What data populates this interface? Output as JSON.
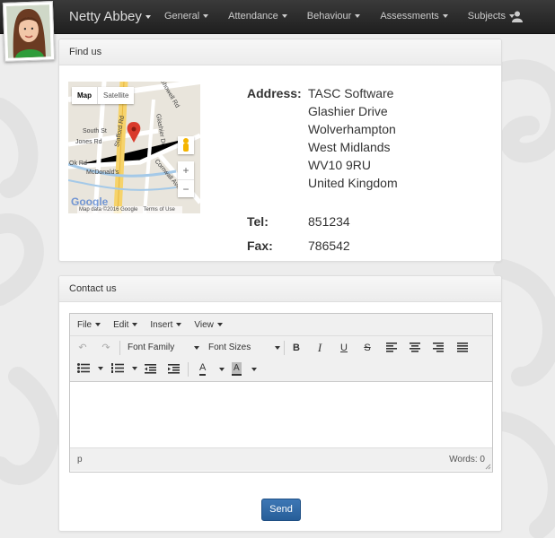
{
  "navbar": {
    "user_name": "Netty Abbey",
    "menu": [
      {
        "label": "General"
      },
      {
        "label": "Attendance"
      },
      {
        "label": "Behaviour"
      },
      {
        "label": "Assessments"
      },
      {
        "label": "Subjects"
      }
    ],
    "user_icon": "user-icon",
    "bg_color": "#2b2b2b"
  },
  "find_us": {
    "title": "Find us",
    "map": {
      "toggle_map": "Map",
      "toggle_satellite": "Satellite",
      "footer_data": "Map data ©2016 Google",
      "footer_terms": "Terms of Use",
      "logo_text": "Google",
      "labels": [
        "Showell Rd",
        "South St",
        "Jones Rd",
        "Stafford Rd",
        "Glashier Dr",
        "McDonald's",
        "Cornwall Ave",
        "Ok Rd"
      ]
    },
    "address_label": "Address:",
    "address_lines": [
      "TASC Software",
      "Glashier Drive",
      "Wolverhampton",
      "West Midlands",
      "WV10 9RU",
      "United Kingdom"
    ],
    "tel_label": "Tel:",
    "tel": "851234",
    "fax_label": "Fax:",
    "fax": "786542"
  },
  "contact_us": {
    "title": "Contact us",
    "editor": {
      "menubar": [
        "File",
        "Edit",
        "Insert",
        "View"
      ],
      "font_family": "Font Family",
      "font_sizes": "Font Sizes",
      "toolbar_icons": [
        "undo-icon",
        "redo-icon",
        "bold-icon",
        "italic-icon",
        "underline-icon",
        "strikethrough-icon",
        "align-left-icon",
        "align-center-icon",
        "align-right-icon",
        "justify-icon",
        "bullet-list-icon",
        "numbered-list-icon",
        "outdent-icon",
        "indent-icon",
        "text-color-icon",
        "background-color-icon"
      ],
      "status_path": "p",
      "word_count": "Words: 0"
    },
    "send_label": "Send",
    "accent": "#2f6aa8"
  }
}
